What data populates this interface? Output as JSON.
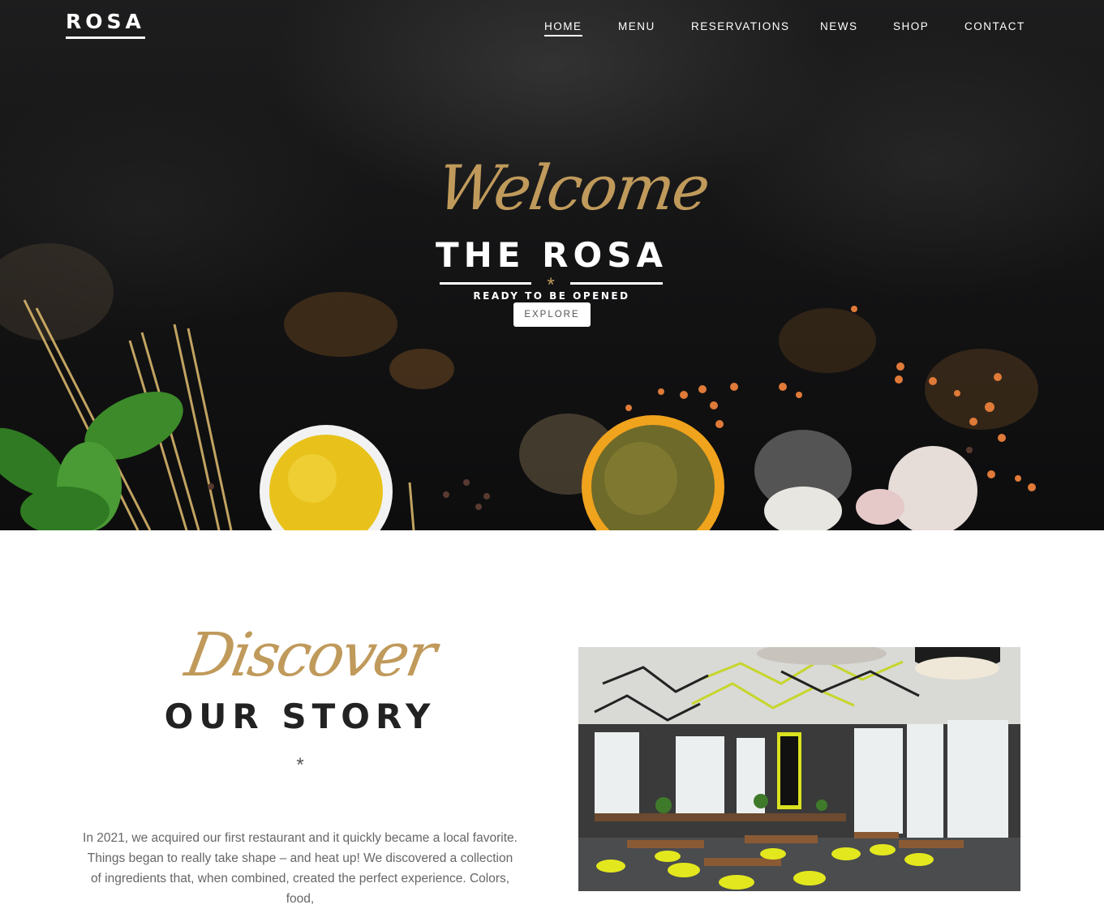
{
  "brand": {
    "logo": "ROSA"
  },
  "nav": {
    "items": [
      {
        "label": "HOME",
        "active": true
      },
      {
        "label": "MENU",
        "active": false
      },
      {
        "label": "RESERVATIONS",
        "active": false
      },
      {
        "label": "NEWS",
        "active": false
      },
      {
        "label": "SHOP",
        "active": false
      },
      {
        "label": "CONTACT",
        "active": false
      }
    ]
  },
  "hero": {
    "script": "Welcome",
    "title": "THE ROSA",
    "divider_glyph": "*",
    "tagline": "READY TO BE OPENED",
    "cta_label": "EXPLORE"
  },
  "story": {
    "script": "Discover",
    "title": "OUR STORY",
    "divider_glyph": "*",
    "text": "In 2021, we acquired our first restaurant and it quickly became a local favorite. Things began to really take shape – and heat up! We discovered a collection of ingredients that, when combined, created the perfect experience. Colors, food,"
  },
  "colors": {
    "accent_gold": "#c09a5b",
    "hero_bg": "#141415",
    "text_dark": "#222222",
    "text_body": "#666666"
  }
}
